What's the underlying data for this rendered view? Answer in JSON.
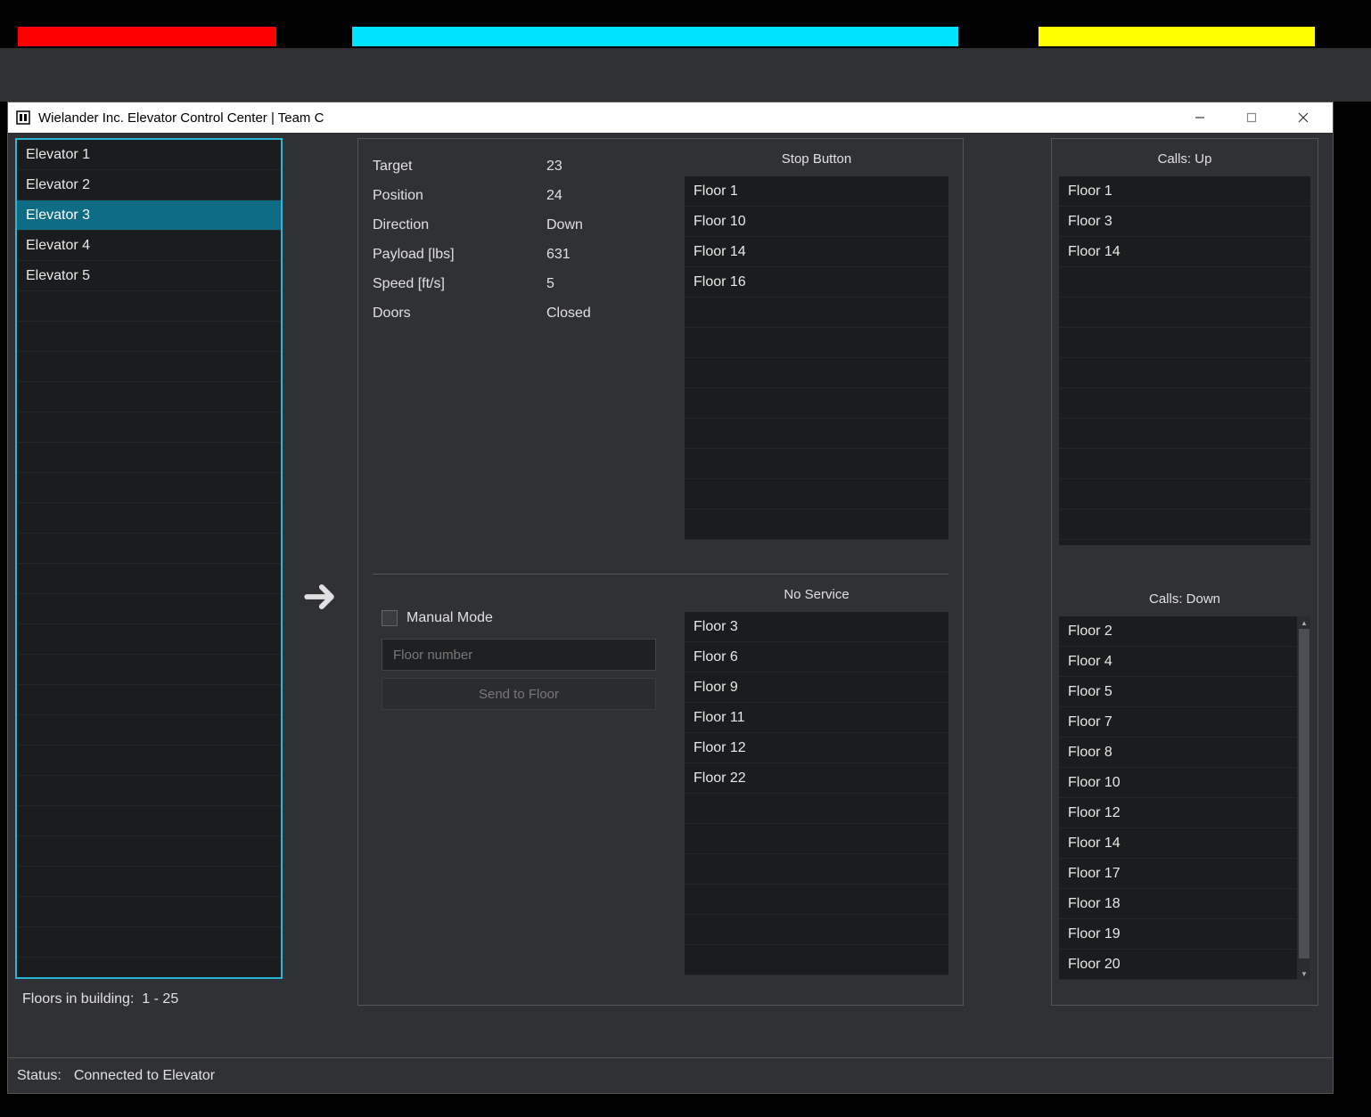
{
  "window": {
    "title": "Wielander Inc. Elevator Control Center | Team C"
  },
  "sidebar": {
    "elevators": [
      "Elevator 1",
      "Elevator 2",
      "Elevator 3",
      "Elevator 4",
      "Elevator 5"
    ],
    "selected_index": 2,
    "floors_label": "Floors in building:",
    "floors_range": "1 - 25"
  },
  "details": {
    "rows": [
      {
        "label": "Target",
        "value": "23"
      },
      {
        "label": "Position",
        "value": "24"
      },
      {
        "label": "Direction",
        "value": "Down"
      },
      {
        "label": "Payload [lbs]",
        "value": "631"
      },
      {
        "label": "Speed [ft/s]",
        "value": "5"
      },
      {
        "label": "Doors",
        "value": "Closed"
      }
    ],
    "stop_header": "Stop Button",
    "stop_floors": [
      "Floor 1",
      "Floor 10",
      "Floor 14",
      "Floor 16"
    ],
    "manual_label": "Manual Mode",
    "floor_placeholder": "Floor number",
    "send_label": "Send to Floor",
    "noservice_header": "No Service",
    "noservice_floors": [
      "Floor 3",
      "Floor 6",
      "Floor 9",
      "Floor 11",
      "Floor 12",
      "Floor 22"
    ]
  },
  "calls": {
    "up_header": "Calls: Up",
    "up": [
      "Floor 1",
      "Floor 3",
      "Floor 14"
    ],
    "down_header": "Calls: Down",
    "down": [
      "Floor 2",
      "Floor 4",
      "Floor 5",
      "Floor 7",
      "Floor 8",
      "Floor 10",
      "Floor 12",
      "Floor 14",
      "Floor 17",
      "Floor 18",
      "Floor 19",
      "Floor 20"
    ]
  },
  "status": {
    "label": "Status:",
    "text": "Connected to Elevator"
  }
}
